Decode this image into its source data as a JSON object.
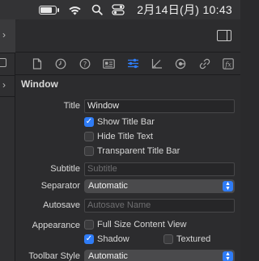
{
  "menubar": {
    "clock": "2月14日(月)  10:43",
    "icons": [
      "battery-charging-icon",
      "wifi-icon",
      "spotlight-search-icon",
      "control-center-icon"
    ]
  },
  "inspector": {
    "tabs": [
      {
        "name": "file-inspector-icon",
        "active": false
      },
      {
        "name": "history-inspector-icon",
        "active": false
      },
      {
        "name": "quick-help-icon",
        "active": false
      },
      {
        "name": "identity-inspector-icon",
        "active": false
      },
      {
        "name": "attributes-inspector-icon",
        "active": true
      },
      {
        "name": "size-inspector-icon",
        "active": false
      },
      {
        "name": "connections-inspector-icon",
        "active": false
      },
      {
        "name": "bindings-inspector-icon",
        "active": false
      },
      {
        "name": "effects-inspector-icon",
        "active": false
      }
    ],
    "section_title": "Window",
    "title_label": "Title",
    "title_value": "Window",
    "show_title_bar": {
      "label": "Show Title Bar",
      "checked": true
    },
    "hide_title_text": {
      "label": "Hide Title Text",
      "checked": false
    },
    "transparent_title_bar": {
      "label": "Transparent Title Bar",
      "checked": false
    },
    "subtitle_label": "Subtitle",
    "subtitle_placeholder": "Subtitle",
    "separator_label": "Separator",
    "separator_value": "Automatic",
    "autosave_label": "Autosave",
    "autosave_placeholder": "Autosave Name",
    "appearance_label": "Appearance",
    "full_size_content_view": {
      "label": "Full Size Content View",
      "checked": false
    },
    "shadow": {
      "label": "Shadow",
      "checked": true
    },
    "textured": {
      "label": "Textured",
      "checked": false
    },
    "toolbar_style_label": "Toolbar Style",
    "toolbar_style_value": "Automatic"
  },
  "colors": {
    "accent": "#2f7cf6",
    "panel_bg": "#2c2c2e"
  }
}
